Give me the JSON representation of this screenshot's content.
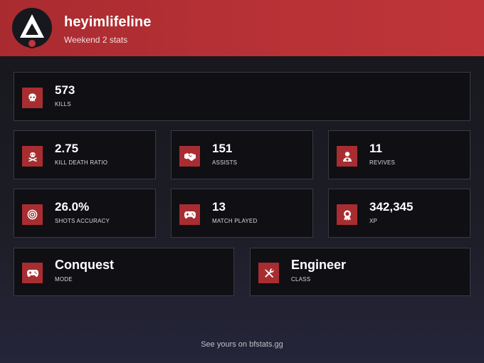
{
  "profile": {
    "username": "heyimlifeline",
    "subtitle": "Weekend 2 stats"
  },
  "stats": {
    "kills": {
      "value": "573",
      "label": "KILLS",
      "icon": "skull-icon"
    },
    "kd": {
      "value": "2.75",
      "label": "KILL DEATH RATIO",
      "icon": "skull-crossbones-icon"
    },
    "assists": {
      "value": "151",
      "label": "ASSISTS",
      "icon": "handshake-icon"
    },
    "revives": {
      "value": "11",
      "label": "REVIVES",
      "icon": "medic-icon"
    },
    "accuracy": {
      "value": "26.0%",
      "label": "SHOTS ACCURACY",
      "icon": "target-icon"
    },
    "matches": {
      "value": "13",
      "label": "MATCH PLAYED",
      "icon": "gamepad-icon"
    },
    "xp": {
      "value": "342,345",
      "label": "XP",
      "icon": "medal-icon"
    },
    "mode": {
      "value": "Conquest",
      "label": "MODE",
      "icon": "gamepad-icon"
    },
    "class": {
      "value": "Engineer",
      "label": "CLASS",
      "icon": "wrench-screwdriver-icon"
    }
  },
  "footer": {
    "text": "See yours on bfstats.gg"
  },
  "colors": {
    "accent": "#b83236",
    "card_bg": "#0f0f14",
    "card_border": "#3a3a46"
  }
}
